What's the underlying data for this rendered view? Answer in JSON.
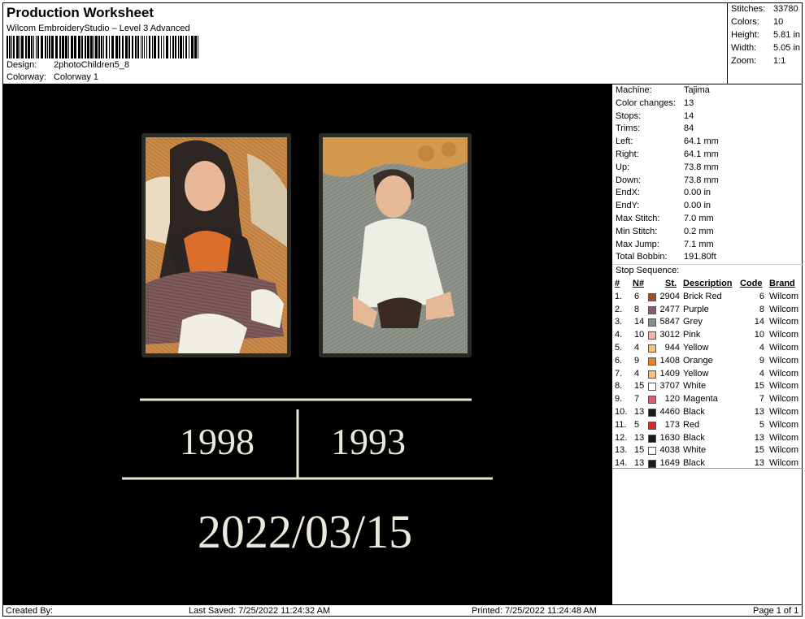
{
  "header": {
    "title": "Production Worksheet",
    "software": "Wilcom EmbroideryStudio – Level 3 Advanced",
    "design_label": "Design:",
    "design_value": "2photoChildren5_8",
    "colorway_label": "Colorway:",
    "colorway_value": "Colorway 1"
  },
  "stats": [
    {
      "label": "Stitches:",
      "value": "33780"
    },
    {
      "label": "Colors:",
      "value": "10"
    },
    {
      "label": "Height:",
      "value": "5.81 in"
    },
    {
      "label": "Width:",
      "value": "5.05 in"
    },
    {
      "label": "Zoom:",
      "value": "1:1"
    }
  ],
  "machine_info": [
    {
      "label": "Machine:",
      "value": "Tajima"
    },
    {
      "label": "Color changes:",
      "value": "13"
    },
    {
      "label": "Stops:",
      "value": "14"
    },
    {
      "label": "Trims:",
      "value": "84"
    },
    {
      "label": "Left:",
      "value": "64.1 mm"
    },
    {
      "label": "Right:",
      "value": "64.1 mm"
    },
    {
      "label": "Up:",
      "value": "73.8 mm"
    },
    {
      "label": "Down:",
      "value": "73.8 mm"
    },
    {
      "label": "EndX:",
      "value": "0.00 in"
    },
    {
      "label": "EndY:",
      "value": "0.00 in"
    },
    {
      "label": "Max Stitch:",
      "value": "7.0 mm"
    },
    {
      "label": "Min Stitch:",
      "value": "0.2 mm"
    },
    {
      "label": "Max Jump:",
      "value": "7.1 mm"
    },
    {
      "label": "Total Bobbin:",
      "value": "191.80ft"
    }
  ],
  "stop_sequence": {
    "title": "Stop Sequence:",
    "headers": {
      "idx": "#",
      "n": "N#",
      "st": "St.",
      "desc": "Description",
      "code": "Code",
      "brand": "Brand"
    },
    "rows": [
      {
        "idx": "1.",
        "n": "6",
        "color": "#a0522d",
        "st": "2904",
        "desc": "Brick Red",
        "code": "6",
        "brand": "Wilcom"
      },
      {
        "idx": "2.",
        "n": "8",
        "color": "#8b5a7a",
        "st": "2477",
        "desc": "Purple",
        "code": "8",
        "brand": "Wilcom"
      },
      {
        "idx": "3.",
        "n": "14",
        "color": "#8c8c8c",
        "st": "5847",
        "desc": "Grey",
        "code": "14",
        "brand": "Wilcom"
      },
      {
        "idx": "4.",
        "n": "10",
        "color": "#f2b8a0",
        "st": "3012",
        "desc": "Pink",
        "code": "10",
        "brand": "Wilcom"
      },
      {
        "idx": "5.",
        "n": "4",
        "color": "#f7c07a",
        "st": "944",
        "desc": "Yellow",
        "code": "4",
        "brand": "Wilcom"
      },
      {
        "idx": "6.",
        "n": "9",
        "color": "#e8822a",
        "st": "1408",
        "desc": "Orange",
        "code": "9",
        "brand": "Wilcom"
      },
      {
        "idx": "7.",
        "n": "4",
        "color": "#f7c07a",
        "st": "1409",
        "desc": "Yellow",
        "code": "4",
        "brand": "Wilcom"
      },
      {
        "idx": "8.",
        "n": "15",
        "color": "#ffffff",
        "st": "3707",
        "desc": "White",
        "code": "15",
        "brand": "Wilcom"
      },
      {
        "idx": "9.",
        "n": "7",
        "color": "#d9606a",
        "st": "120",
        "desc": "Magenta",
        "code": "7",
        "brand": "Wilcom"
      },
      {
        "idx": "10.",
        "n": "13",
        "color": "#1a1a1a",
        "st": "4460",
        "desc": "Black",
        "code": "13",
        "brand": "Wilcom"
      },
      {
        "idx": "11.",
        "n": "5",
        "color": "#d42a2a",
        "st": "173",
        "desc": "Red",
        "code": "5",
        "brand": "Wilcom"
      },
      {
        "idx": "12.",
        "n": "13",
        "color": "#1a1a1a",
        "st": "1630",
        "desc": "Black",
        "code": "13",
        "brand": "Wilcom"
      },
      {
        "idx": "13.",
        "n": "15",
        "color": "#ffffff",
        "st": "4038",
        "desc": "White",
        "code": "15",
        "brand": "Wilcom"
      },
      {
        "idx": "14.",
        "n": "13",
        "color": "#1a1a1a",
        "st": "1649",
        "desc": "Black",
        "code": "13",
        "brand": "Wilcom"
      }
    ]
  },
  "design": {
    "year_left": "1998",
    "year_right": "1993",
    "date": "2022/03/15"
  },
  "footer": {
    "created_by": "Created By:",
    "last_saved": "Last Saved: 7/25/2022 11:24:32 AM",
    "printed": "Printed: 7/25/2022 11:24:48 AM",
    "page": "Page 1 of 1"
  }
}
